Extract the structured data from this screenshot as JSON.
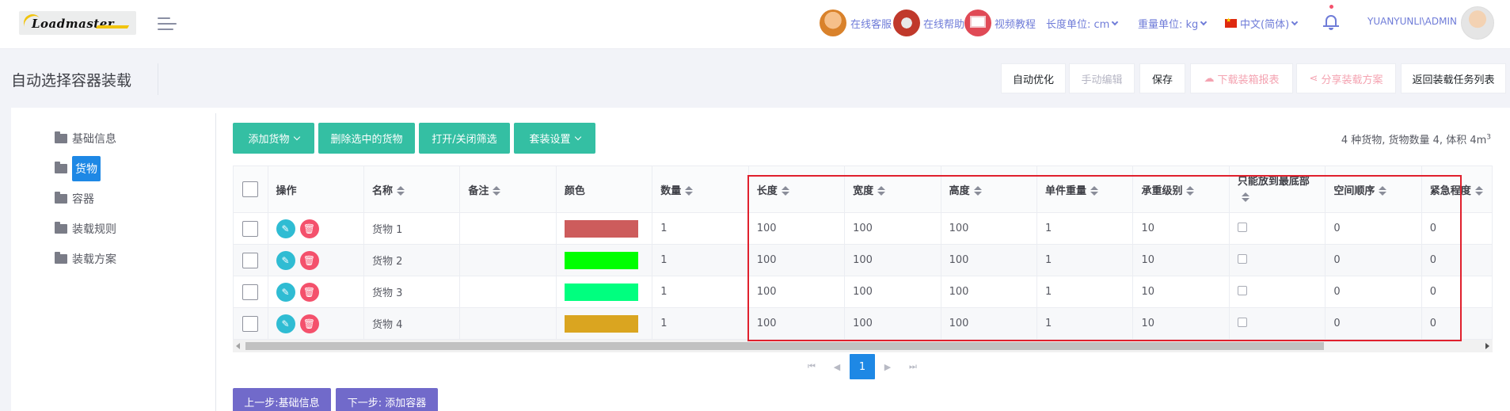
{
  "header": {
    "logo_text": "Loadmaster",
    "online_service": "在线客服",
    "online_help": "在线帮助",
    "video_tutorial": "视频教程",
    "length_unit": "长度单位: cm",
    "weight_unit": "重量单位: kg",
    "language": "中文(简体)",
    "username": "YUANYUNLI\\ADMIN"
  },
  "page": {
    "title": "自动选择容器装载",
    "toolbar": {
      "auto_optimize": "自动优化",
      "manual_edit": "手动编辑",
      "save": "保存",
      "download_report": "下载装箱报表",
      "share_plan": "分享装载方案",
      "back_to_list": "返回装载任务列表"
    }
  },
  "sidebar": {
    "items": [
      {
        "label": "基础信息",
        "active": false
      },
      {
        "label": "货物",
        "active": true
      },
      {
        "label": "容器",
        "active": false
      },
      {
        "label": "装载规则",
        "active": false
      },
      {
        "label": "装载方案",
        "active": false
      }
    ]
  },
  "actions": {
    "add_cargo": "添加货物",
    "delete_selected": "删除选中的货物",
    "toggle_filter": "打开/关闭筛选",
    "kit_settings": "套装设置"
  },
  "summary": {
    "text": "4 种货物, 货物数量 4, 体积 4m",
    "superscript": "3"
  },
  "table": {
    "headers": {
      "ops": "操作",
      "name": "名称",
      "note": "备注",
      "color": "颜色",
      "quantity": "数量",
      "length": "长度",
      "width": "宽度",
      "height": "高度",
      "unit_weight": "单件重量",
      "load_bearing": "承重级别",
      "top_only": "只能放到最底部",
      "space_order": "空间顺序",
      "urgency": "紧急程度"
    },
    "rows": [
      {
        "name": "货物 1",
        "note": "",
        "color": "#cd5c5c",
        "quantity": "1",
        "length": "100",
        "width": "100",
        "height": "100",
        "unit_weight": "1",
        "load_bearing": "10",
        "space_order": "0",
        "urgency": "0"
      },
      {
        "name": "货物 2",
        "note": "",
        "color": "#00ff00",
        "quantity": "1",
        "length": "100",
        "width": "100",
        "height": "100",
        "unit_weight": "1",
        "load_bearing": "10",
        "space_order": "0",
        "urgency": "0"
      },
      {
        "name": "货物 3",
        "note": "",
        "color": "#00ff7f",
        "quantity": "1",
        "length": "100",
        "width": "100",
        "height": "100",
        "unit_weight": "1",
        "load_bearing": "10",
        "space_order": "0",
        "urgency": "0"
      },
      {
        "name": "货物 4",
        "note": "",
        "color": "#daa520",
        "quantity": "1",
        "length": "100",
        "width": "100",
        "height": "100",
        "unit_weight": "1",
        "load_bearing": "10",
        "space_order": "0",
        "urgency": "0"
      }
    ]
  },
  "pagination": {
    "current_page": "1"
  },
  "footer": {
    "prev_step": "上一步:基础信息",
    "next_step": "下一步: 添加容器"
  },
  "colors": {
    "accent_green": "#34bfa3",
    "primary_blue": "#1e88e5",
    "purple": "#716aca",
    "highlight_red": "#e0202d"
  }
}
